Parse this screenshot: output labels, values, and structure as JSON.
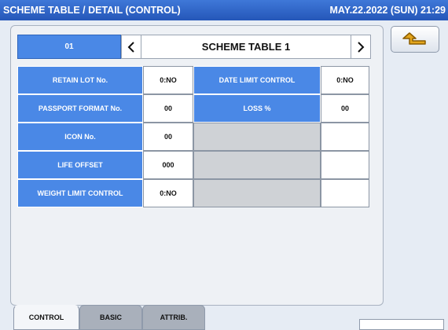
{
  "titlebar": {
    "title": "SCHEME TABLE / DETAIL (CONTROL)",
    "datetime": "MAY.22.2022 (SUN) 21:29"
  },
  "header": {
    "scheme_id": "01",
    "scheme_name": "SCHEME TABLE 1"
  },
  "fields": {
    "retain_lot": {
      "label": "RETAIN LOT No.",
      "value": "0:NO"
    },
    "date_limit_control": {
      "label": "DATE LIMIT CONTROL",
      "value": "0:NO"
    },
    "passport_format": {
      "label": "PASSPORT FORMAT No.",
      "value": "00"
    },
    "loss": {
      "label": "LOSS %",
      "value": "00"
    },
    "icon_no": {
      "label": "ICON No.",
      "value": "00"
    },
    "life_offset": {
      "label": "LIFE OFFSET",
      "value": "000"
    },
    "weight_limit_control": {
      "label": "WEIGHT LIMIT CONTROL",
      "value": "0:NO"
    }
  },
  "tabs": {
    "control": "CONTROL",
    "basic": "BASIC",
    "attrib": "ATTRIB."
  },
  "colors": {
    "accent_blue": "#4a88e6",
    "titlebar_blue": "#2f64c6",
    "back_arrow": "#e3a51c"
  }
}
